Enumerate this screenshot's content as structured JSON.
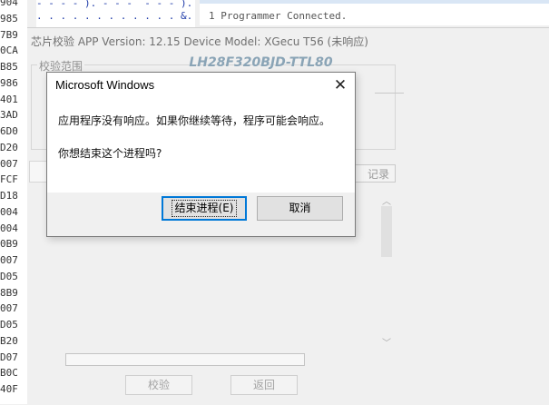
{
  "background": {
    "hex_column": [
      "904",
      "985",
      "7B9",
      "0CA",
      "B85",
      "986",
      "401",
      "3AD",
      "6D0",
      "D20",
      "007",
      "FCF",
      "D18",
      "004",
      "004",
      "0B9",
      "007",
      "D05",
      "8B9",
      "007",
      "D05",
      "B20",
      "D07",
      "B0C",
      "40F"
    ],
    "code_lines": [
      "- - - - ). - - -  - - - ).",
      ". . . . . . . . . . . . &. ."
    ],
    "log_line": "1 Programmer Connected."
  },
  "verify_window": {
    "title": "芯片校验    APP Version: 12.15 Device Model: XGecu T56 (未响应)",
    "device_name": "LH28F320BJD-TTL80",
    "range_group_label": "校验范围",
    "log_button_label": "记录",
    "verify_button_label": "校验",
    "back_button_label": "返回"
  },
  "dialog": {
    "title": "Microsoft Windows",
    "close_glyph": "✕",
    "message_line1": "应用程序没有响应。如果你继续等待，程序可能会响应。",
    "message_line2": "你想结束这个进程吗?",
    "end_button_label": "结束进程(E)",
    "cancel_button_label": "取消"
  }
}
